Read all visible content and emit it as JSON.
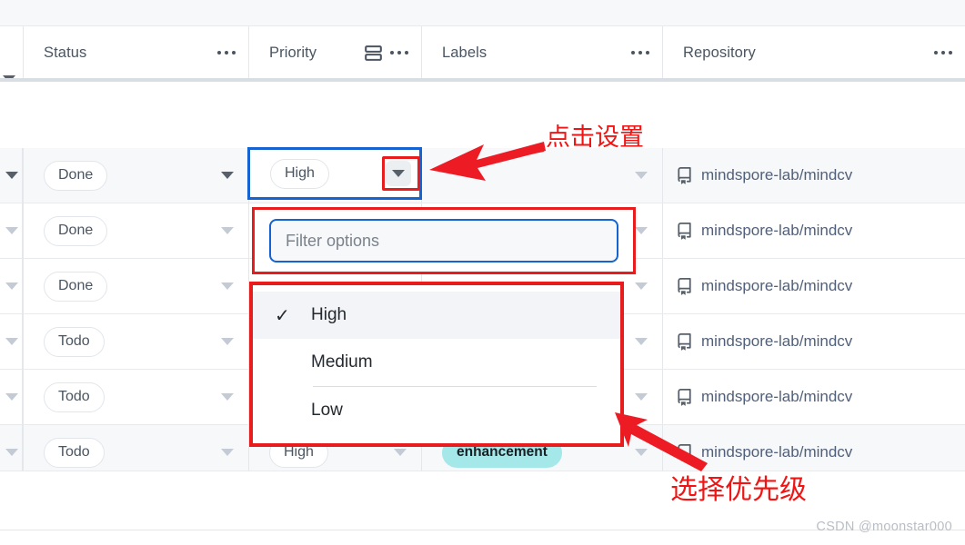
{
  "table": {
    "columns": [
      {
        "id": "status",
        "label": "Status",
        "icon": "",
        "menu_icon": "kebab-icon",
        "active": false
      },
      {
        "id": "priority",
        "label": "Priority",
        "icon": "rows-icon",
        "menu_icon": "kebab-icon",
        "active": true
      },
      {
        "id": "labels",
        "label": "Labels",
        "icon": "",
        "menu_icon": "kebab-icon",
        "active": false
      },
      {
        "id": "repository",
        "label": "Repository",
        "icon": "",
        "menu_icon": "kebab-icon",
        "active": false
      }
    ],
    "rows": [
      {
        "status": "Done",
        "priority": "High",
        "labels": "",
        "repository": "mindspore-lab/mindcv",
        "hovered": true
      },
      {
        "status": "Done",
        "priority": "",
        "labels": "",
        "repository": "mindspore-lab/mindcv",
        "hovered": false
      },
      {
        "status": "Done",
        "priority": "",
        "labels": "",
        "repository": "mindspore-lab/mindcv",
        "hovered": false
      },
      {
        "status": "Todo",
        "priority": "",
        "labels": "",
        "repository": "mindspore-lab/mindcv",
        "hovered": false
      },
      {
        "status": "Todo",
        "priority": "",
        "labels": "",
        "repository": "mindspore-lab/mindcv",
        "hovered": false
      },
      {
        "status": "Todo",
        "priority": "High",
        "labels": "enhancement",
        "repository": "mindspore-lab/mindcv",
        "hovered": false
      }
    ]
  },
  "selected_cell": {
    "value": "High",
    "caret_icon": "chevron-down-icon"
  },
  "dropdown": {
    "filter": {
      "placeholder": "Filter options",
      "value": ""
    },
    "options": [
      {
        "label": "High",
        "selected": true,
        "check_icon": "check-icon"
      },
      {
        "label": "Medium",
        "selected": false,
        "check_icon": ""
      },
      {
        "label": "Low",
        "selected": false,
        "check_icon": ""
      }
    ]
  },
  "annotations": [
    {
      "id": "click-settings",
      "text": "点击设置"
    },
    {
      "id": "select-priority",
      "text": "选择优先级"
    }
  ],
  "watermark": "CSDN @moonstar000",
  "colors": {
    "annotation_red": "#e81c1c",
    "focus_blue": "#1563d1",
    "label_teal": "#a5e8ea",
    "row_hover": "#f6f8fa"
  }
}
